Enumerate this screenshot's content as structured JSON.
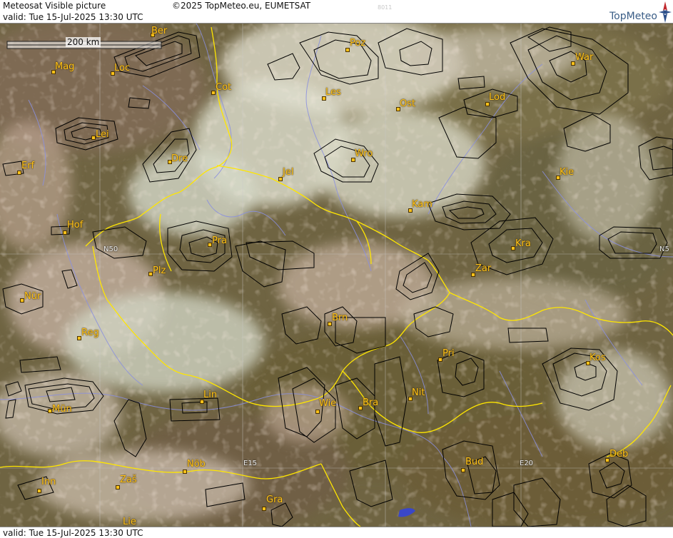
{
  "header": {
    "title": "Meteosat Visible picture",
    "valid": "valid:  Tue  15-Jul-2025  13:30 UTC",
    "copyright": "©2025 TopMeteo.eu, EUMETSAT",
    "code": "8011",
    "brand": "TopMeteo"
  },
  "footer": {
    "valid": "valid:  Tue  15-Jul-2025  13:30 UTC"
  },
  "scale": {
    "label": "200 km"
  },
  "grid_labels": {
    "n50": "N50",
    "n50_right": "N5",
    "e15": "E15",
    "e20": "E20"
  },
  "cities": [
    {
      "name": "Ber"
    },
    {
      "name": "Mag"
    },
    {
      "name": "Loc"
    },
    {
      "name": "Cot"
    },
    {
      "name": "Poz"
    },
    {
      "name": "War"
    },
    {
      "name": "Les"
    },
    {
      "name": "Ost"
    },
    {
      "name": "Lod"
    },
    {
      "name": "Lei"
    },
    {
      "name": "Dre"
    },
    {
      "name": "Wro"
    },
    {
      "name": "Erf"
    },
    {
      "name": "Jel"
    },
    {
      "name": "Kie"
    },
    {
      "name": "Kam"
    },
    {
      "name": "Hof"
    },
    {
      "name": "Pra"
    },
    {
      "name": "Kra"
    },
    {
      "name": "Plz"
    },
    {
      "name": "Zar"
    },
    {
      "name": "Nür"
    },
    {
      "name": "Brn"
    },
    {
      "name": "Reg"
    },
    {
      "name": "Pri"
    },
    {
      "name": "Kos"
    },
    {
      "name": "Mün"
    },
    {
      "name": "Lin"
    },
    {
      "name": "Wie"
    },
    {
      "name": "Bra"
    },
    {
      "name": "Nit"
    },
    {
      "name": "Nöb"
    },
    {
      "name": "Bud"
    },
    {
      "name": "Deb"
    },
    {
      "name": "Inn"
    },
    {
      "name": "Zaš"
    },
    {
      "name": "Gra"
    },
    {
      "name": "Lie"
    }
  ],
  "colors": {
    "city_label": "#ffc21a",
    "borders": "#ffe600",
    "rivers": "#8a8fe0",
    "warning_outlines": "#000000",
    "brand": "#3a5d86"
  }
}
